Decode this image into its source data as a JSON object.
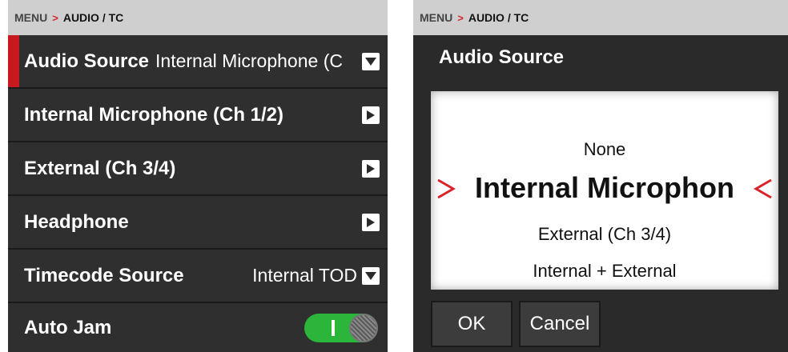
{
  "left": {
    "breadcrumb": {
      "menu": "MENU",
      "arrow": ">",
      "section": "AUDIO / TC"
    },
    "rows": [
      {
        "label": "Audio Source",
        "value": "Internal Microphone (C",
        "control": "dropdown-icon"
      },
      {
        "label": "Internal Microphone (Ch 1/2)",
        "control": "arrow-right-icon"
      },
      {
        "label": "External (Ch 3/4)",
        "control": "arrow-right-icon"
      },
      {
        "label": "Headphone",
        "control": "arrow-right-icon"
      },
      {
        "label": "Timecode Source",
        "value": "Internal TOD",
        "control": "dropdown-icon"
      },
      {
        "label": "Auto Jam",
        "control": "toggle",
        "toggle_on": true
      }
    ]
  },
  "right": {
    "breadcrumb": {
      "menu": "MENU",
      "arrow": ">",
      "section": "AUDIO / TC"
    },
    "dialog": {
      "title": "Audio Source",
      "options": [
        "None",
        "Internal Microphon",
        "External (Ch 3/4)",
        "Internal + External"
      ],
      "selected_index": 1,
      "ok_label": "OK",
      "cancel_label": "Cancel"
    }
  },
  "colors": {
    "accent": "#d8232a",
    "toggle_on": "#2bb53b",
    "background": "#2f2f2f"
  }
}
